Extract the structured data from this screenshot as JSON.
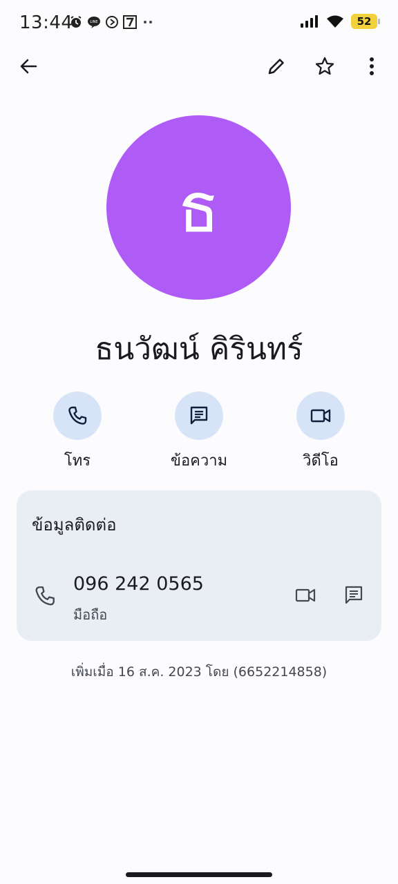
{
  "status_bar": {
    "time": "13:44",
    "battery": "52",
    "left_icons": [
      "alarm-icon",
      "line-icon",
      "play-icon",
      "seven-eleven-icon",
      "more-dots-icon"
    ],
    "right_icons": [
      "signal-icon",
      "wifi-icon",
      "battery-icon"
    ]
  },
  "top_bar": {
    "icons": [
      "back-arrow-icon",
      "edit-pencil-icon",
      "star-outline-icon",
      "more-vert-icon"
    ]
  },
  "avatar": {
    "initial": "ธ",
    "color": "#ae5cf5"
  },
  "contact": {
    "name": "ธนวัฒน์ คิรินทร์"
  },
  "actions": [
    {
      "label": "โทร",
      "icon": "phone-icon"
    },
    {
      "label": "ข้อความ",
      "icon": "message-icon"
    },
    {
      "label": "วิดีโอ",
      "icon": "video-icon"
    }
  ],
  "contact_info": {
    "title": "ข้อมูลติดต่อ",
    "phone": {
      "number": "096 242 0565",
      "type": "มือถือ"
    }
  },
  "added_info": "เพิ่มเมื่อ 16 ส.ค. 2023 โดย (6652214858)",
  "colors": {
    "accent_circle": "#d7e3f7",
    "card_bg": "#e9eef5",
    "icon": "#0f1f3a"
  }
}
